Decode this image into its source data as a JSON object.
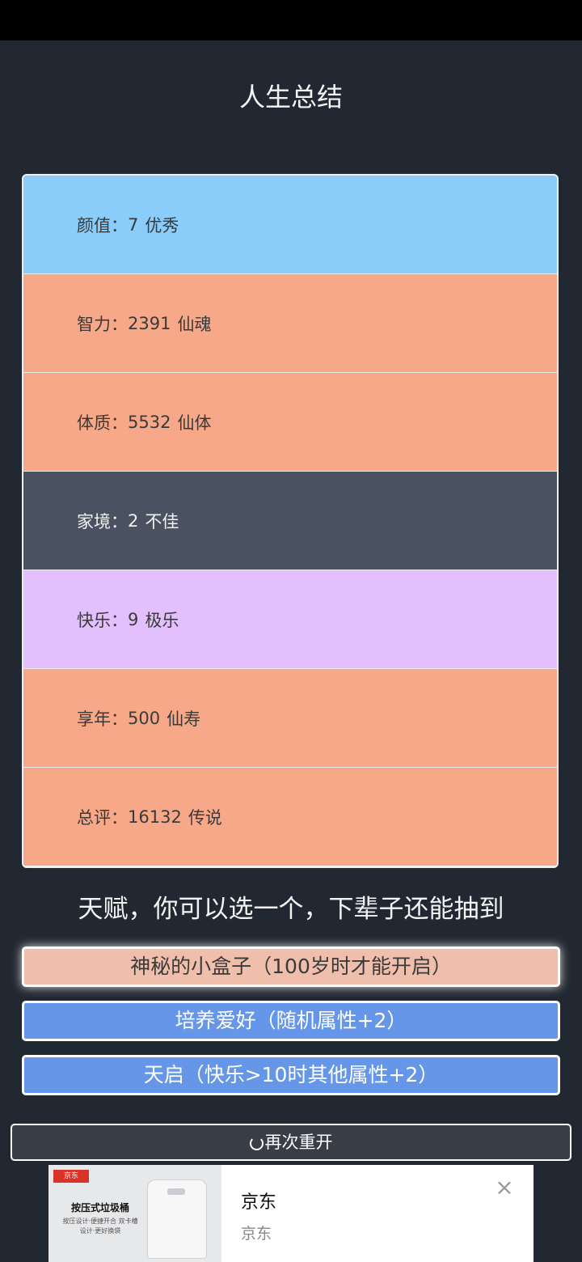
{
  "page_title": "人生总结",
  "summary": [
    {
      "label": "颜值：",
      "value": "7",
      "grade": "优秀",
      "color": "#8accfa"
    },
    {
      "label": "智力：",
      "value": "2391",
      "grade": "仙魂",
      "color": "#f6a888"
    },
    {
      "label": "体质：",
      "value": "5532",
      "grade": "仙体",
      "color": "#f6a888"
    },
    {
      "label": "家境：",
      "value": "2",
      "grade": "不佳",
      "color": "#4a5261"
    },
    {
      "label": "快乐：",
      "value": "9",
      "grade": "极乐",
      "color": "#e3c0fd"
    },
    {
      "label": "享年：",
      "value": "500",
      "grade": "仙寿",
      "color": "#f6a888"
    },
    {
      "label": "总评：",
      "value": "16132",
      "grade": "传说",
      "color": "#f6a888"
    }
  ],
  "talent_heading": "天赋，你可以选一个，下辈子还能抽到",
  "talents": [
    {
      "label": "神秘的小盒子（100岁时才能开启）",
      "selected": true
    },
    {
      "label": "培养爱好（随机属性+2）",
      "selected": false
    },
    {
      "label": "天启（快乐>10时其他属性+2）",
      "selected": false
    }
  ],
  "restart_label": "再次重开",
  "ad": {
    "logo_text": "京东",
    "product_name": "按压式垃圾桶",
    "product_desc": "按压设计·便捷开合 双卡槽设计·更好换袋",
    "title": "京东",
    "source": "京东",
    "close_icon": "close-icon"
  }
}
